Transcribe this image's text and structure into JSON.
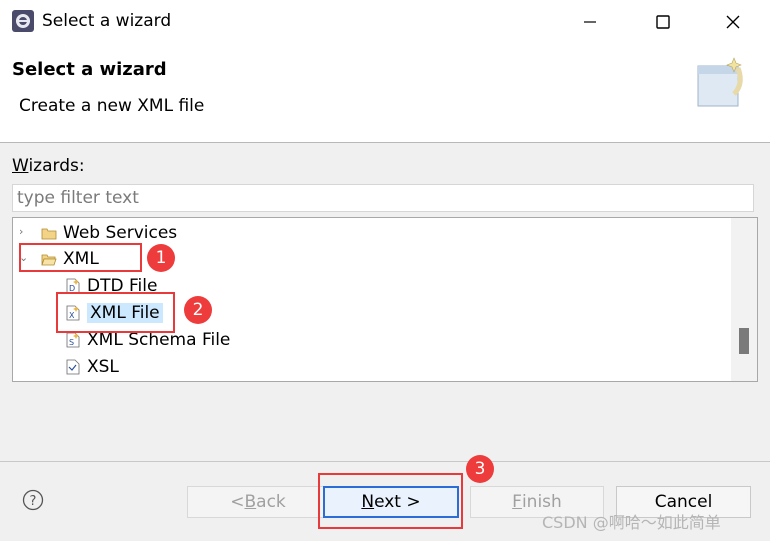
{
  "window": {
    "title": "Select a wizard"
  },
  "banner": {
    "title": "Select a wizard",
    "description": "Create a new XML file"
  },
  "wizards": {
    "label_mnemonic": "W",
    "label_rest": "izards:",
    "filter_placeholder": "type filter text",
    "filter_value": ""
  },
  "tree": {
    "items": [
      {
        "label": "Web Services",
        "expanded": false,
        "icon": "folder-icon"
      },
      {
        "label": "XML",
        "expanded": true,
        "icon": "folder-open-icon"
      },
      {
        "label": "DTD File",
        "icon": "dtd-file-icon"
      },
      {
        "label": "XML File",
        "icon": "xml-file-icon",
        "selected": true
      },
      {
        "label": "XML Schema File",
        "icon": "xml-schema-file-icon"
      },
      {
        "label": "XSL",
        "icon": "xsl-file-icon"
      }
    ]
  },
  "buttons": {
    "help": "?",
    "back_prefix": "< ",
    "back_mnemonic": "B",
    "back_rest": "ack",
    "next_mnemonic": "N",
    "next_rest": "ext >",
    "finish_mnemonic": "F",
    "finish_rest": "inish",
    "cancel": "Cancel"
  },
  "annotations": {
    "badge_1": "1",
    "badge_2": "2",
    "badge_3": "3",
    "color": "#e83a3a"
  },
  "watermark": "CSDN @啊哈～如此简单",
  "colors": {
    "selection": "#cce8ff",
    "primary_border": "#2b6cd6",
    "badge": "#ee3c3c"
  }
}
